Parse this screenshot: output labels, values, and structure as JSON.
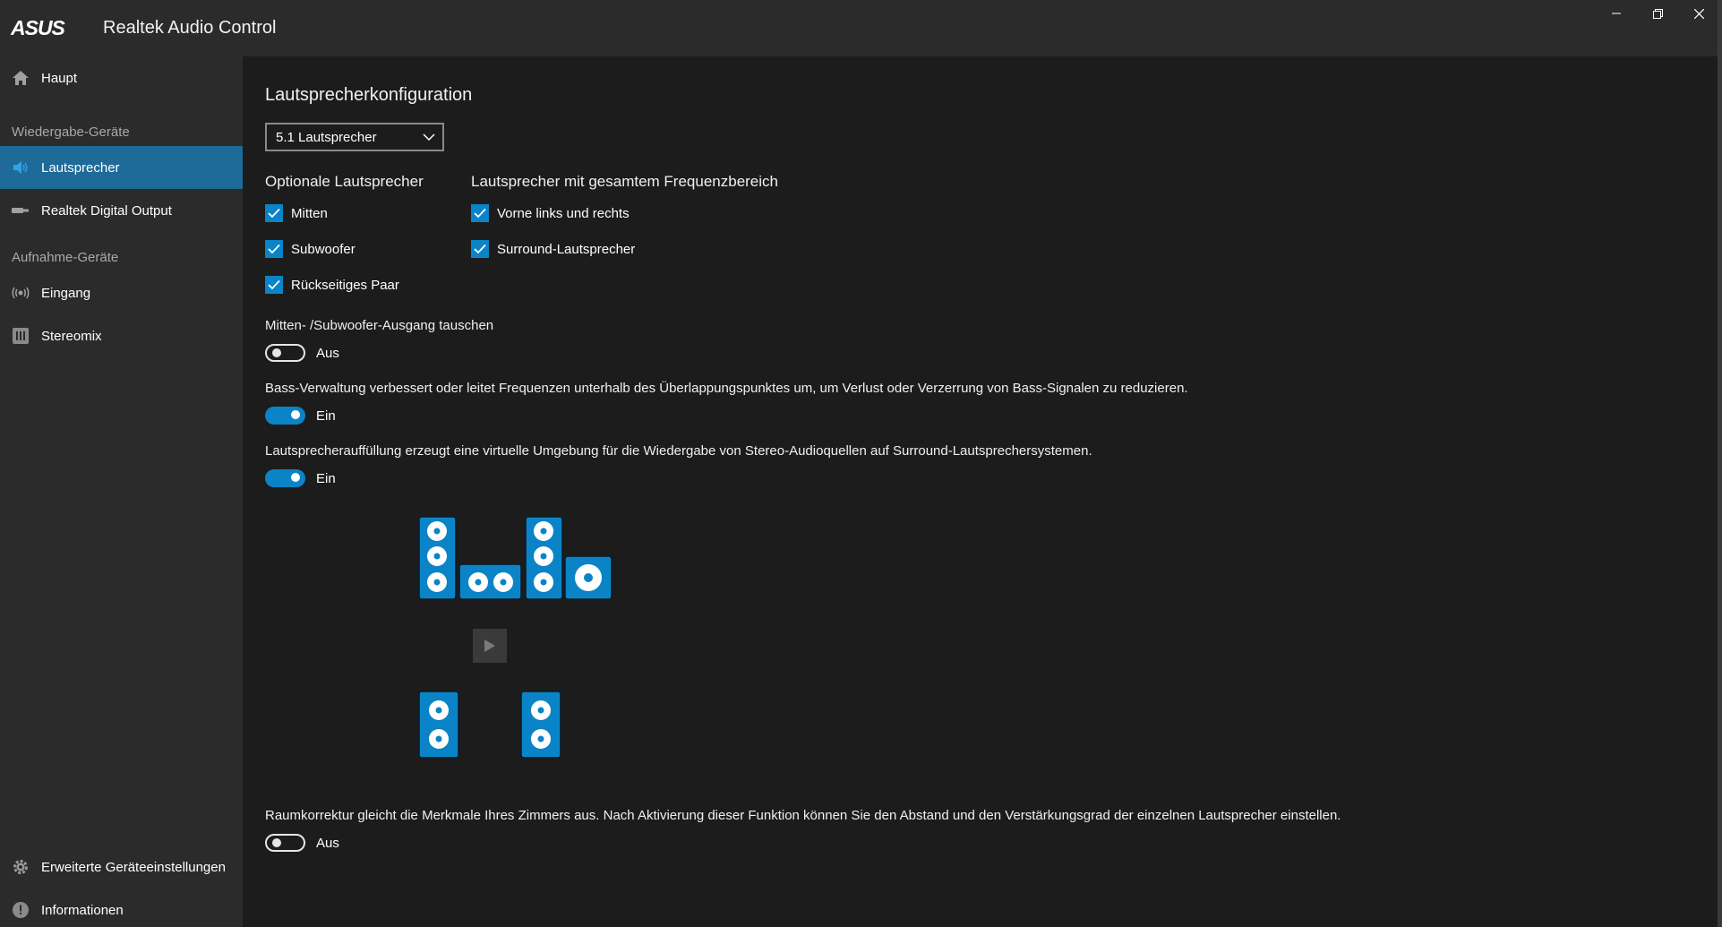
{
  "window": {
    "brand": "ASUS",
    "title": "Realtek Audio Control"
  },
  "sidebar": {
    "home": "Haupt",
    "playback_section": "Wiedergabe-Geräte",
    "playback_items": [
      "Lautsprecher",
      "Realtek Digital Output"
    ],
    "recording_section": "Aufnahme-Geräte",
    "recording_items": [
      "Eingang",
      "Stereomix"
    ],
    "advanced": "Erweiterte Geräteeinstellungen",
    "info": "Informationen"
  },
  "main": {
    "title": "Lautsprecherkonfiguration",
    "config_select": "5.1 Lautsprecher",
    "optional_header": "Optionale Lautsprecher",
    "optional": [
      "Mitten",
      "Subwoofer",
      "Rückseitiges Paar"
    ],
    "fullrange_header": "Lautsprecher mit gesamtem Frequenzbereich",
    "fullrange": [
      "Vorne links und rechts",
      "Surround-Lautsprecher"
    ],
    "swap_desc": "Mitten- /Subwoofer-Ausgang tauschen",
    "swap_state": "Aus",
    "bass_desc": "Bass-Verwaltung verbessert oder leitet Frequenzen unterhalb des Überlappungspunktes um, um Verlust oder Verzerrung von Bass-Signalen zu reduzieren.",
    "bass_state": "Ein",
    "fill_desc": "Lautsprecherauffüllung erzeugt eine virtuelle Umgebung für die Wiedergabe von Stereo-Audioquellen auf Surround-Lautsprechersystemen.",
    "fill_state": "Ein",
    "room_desc": "Raumkorrektur gleicht die Merkmale Ihres Zimmers aus. Nach Aktivierung dieser Funktion können Sie den Abstand und den Verstärkungsgrad der einzelnen Lautsprecher einstellen.",
    "room_state": "Aus"
  },
  "colors": {
    "accent": "#0a84c6",
    "active_nav": "#1e6a98",
    "sidebar_bg": "#2b2b2b",
    "main_bg": "#1c1c1c"
  },
  "icons": [
    "home-icon",
    "speaker-icon",
    "digital-output-icon",
    "microphone-icon",
    "stereomix-icon",
    "gear-icon",
    "info-icon",
    "minimize-icon",
    "maximize-icon",
    "close-icon",
    "chevron-down-icon",
    "play-icon"
  ]
}
